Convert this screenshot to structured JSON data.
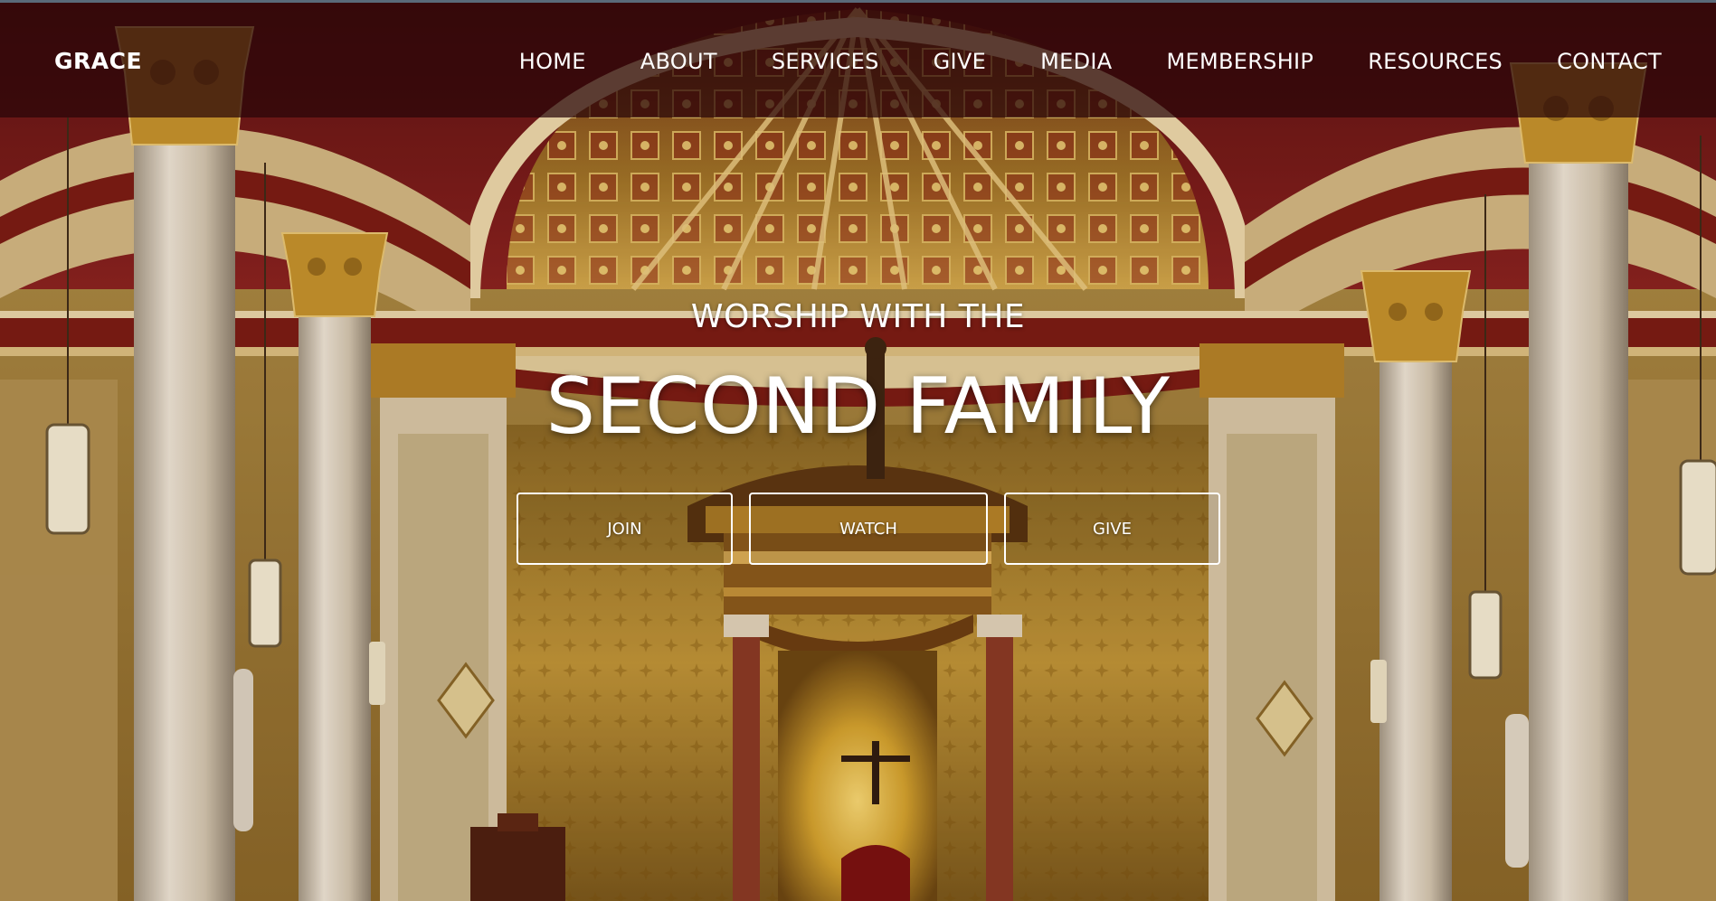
{
  "brand": {
    "name": "GRACE"
  },
  "nav": {
    "items": [
      {
        "label": "HOME"
      },
      {
        "label": "ABOUT"
      },
      {
        "label": "SERVICES"
      },
      {
        "label": "GIVE"
      },
      {
        "label": "MEDIA"
      },
      {
        "label": "MEMBERSHIP"
      },
      {
        "label": "RESOURCES"
      },
      {
        "label": "CONTACT"
      }
    ]
  },
  "hero": {
    "eyebrow": "WORSHIP WITH THE",
    "headline": "SECOND FAMILY",
    "buttons": {
      "join": "JOIN",
      "watch": "WATCH",
      "give": "GIVE"
    },
    "background_image": "church-sanctuary-interior"
  },
  "colors": {
    "nav_overlay": "#280608",
    "text": "#ffffff",
    "gold": "#c9a24a",
    "deep_red": "#7a1414"
  }
}
